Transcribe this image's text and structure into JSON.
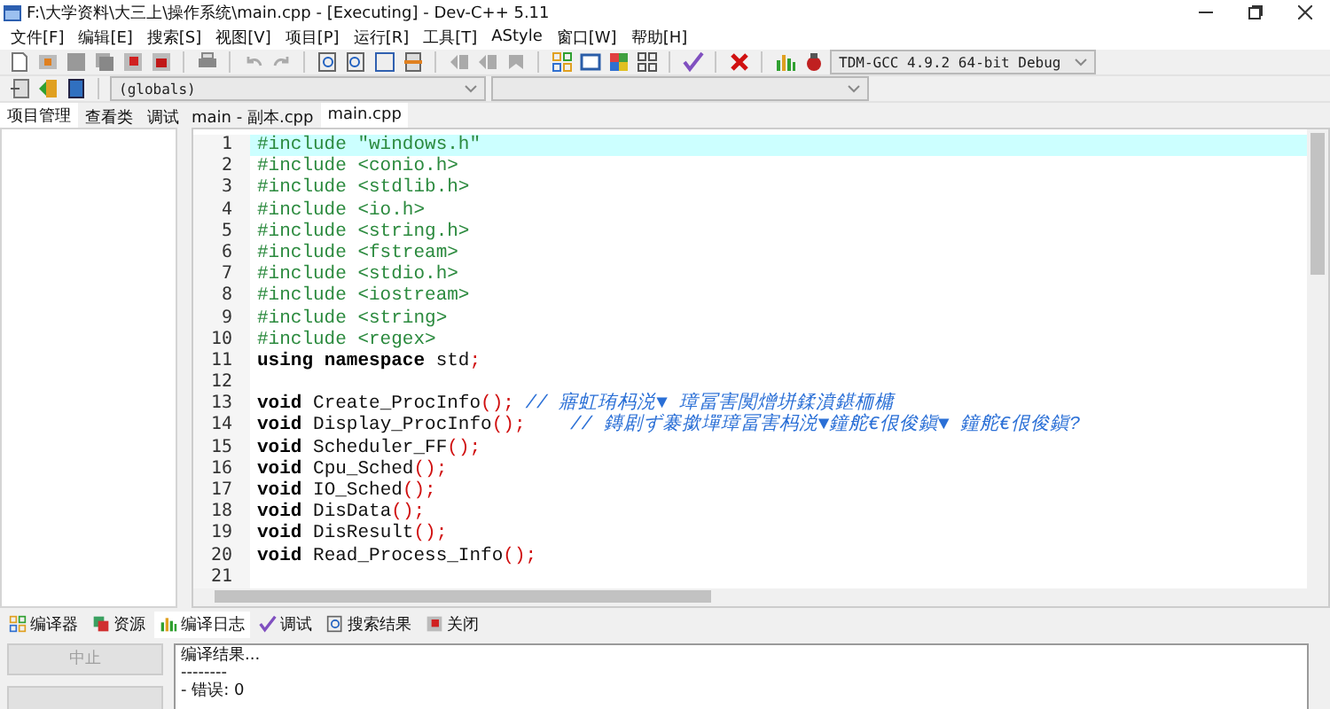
{
  "window": {
    "title": "F:\\大学资料\\大三上\\操作系统\\main.cpp - [Executing] - Dev-C++ 5.11"
  },
  "menu": [
    "文件[F]",
    "编辑[E]",
    "搜索[S]",
    "视图[V]",
    "项目[P]",
    "运行[R]",
    "工具[T]",
    "AStyle",
    "窗口[W]",
    "帮助[H]"
  ],
  "toolbar": {
    "compiler": "TDM-GCC 4.9.2 64-bit Debug",
    "scope": "(globals)"
  },
  "left_tabs": [
    {
      "label": "项目管理",
      "selected": true
    },
    {
      "label": "查看类",
      "selected": false
    },
    {
      "label": "调试",
      "selected": false
    }
  ],
  "editor_tabs": [
    {
      "label": "main - 副本.cpp",
      "selected": false
    },
    {
      "label": "main.cpp",
      "selected": true
    }
  ],
  "code_lines": [
    {
      "number": "1",
      "highlighted": true,
      "tokens": [
        {
          "kind": "pre",
          "text": "#include \"windows.h\""
        }
      ]
    },
    {
      "number": "2",
      "highlighted": false,
      "tokens": [
        {
          "kind": "pre",
          "text": "#include <conio.h>"
        }
      ]
    },
    {
      "number": "3",
      "highlighted": false,
      "tokens": [
        {
          "kind": "pre",
          "text": "#include <stdlib.h>"
        }
      ]
    },
    {
      "number": "4",
      "highlighted": false,
      "tokens": [
        {
          "kind": "pre",
          "text": "#include <io.h>"
        }
      ]
    },
    {
      "number": "5",
      "highlighted": false,
      "tokens": [
        {
          "kind": "pre",
          "text": "#include <string.h>"
        }
      ]
    },
    {
      "number": "6",
      "highlighted": false,
      "tokens": [
        {
          "kind": "pre",
          "text": "#include <fstream>"
        }
      ]
    },
    {
      "number": "7",
      "highlighted": false,
      "tokens": [
        {
          "kind": "pre",
          "text": "#include <stdio.h>"
        }
      ]
    },
    {
      "number": "8",
      "highlighted": false,
      "tokens": [
        {
          "kind": "pre",
          "text": "#include <iostream>"
        }
      ]
    },
    {
      "number": "9",
      "highlighted": false,
      "tokens": [
        {
          "kind": "pre",
          "text": "#include <string>"
        }
      ]
    },
    {
      "number": "10",
      "highlighted": false,
      "tokens": [
        {
          "kind": "pre",
          "text": "#include <regex>"
        }
      ]
    },
    {
      "number": "11",
      "highlighted": false,
      "tokens": [
        {
          "kind": "kw",
          "text": "using"
        },
        {
          "kind": "kw",
          "text": " namespace"
        },
        {
          "kind": "plain",
          "text": " std"
        },
        {
          "kind": "punct",
          "text": ";"
        }
      ]
    },
    {
      "number": "12",
      "highlighted": false
    },
    {
      "number": "13",
      "highlighted": false,
      "tokens": [
        {
          "kind": "kw",
          "text": "void"
        },
        {
          "kind": "plain",
          "text": " Create_ProcInfo"
        },
        {
          "kind": "punct",
          "text": "();"
        },
        {
          "kind": "comment",
          "text": " // 寤虹珛杩涚▼ 璋冨害闃熷垪鍒濆鍖栭槦"
        }
      ]
    },
    {
      "number": "14",
      "highlighted": false,
      "tokens": [
        {
          "kind": "kw",
          "text": "void"
        },
        {
          "kind": "plain",
          "text": " Display_ProcInfo"
        },
        {
          "kind": "punct",
          "text": "();"
        },
        {
          "kind": "comment",
          "text": "    // 鏄剧ず褰撳墠璋冨害杩涚▼鐘舵€佷俊鎭▼ 鐘舵€佷俊鎭?"
        }
      ]
    },
    {
      "number": "15",
      "highlighted": false,
      "tokens": [
        {
          "kind": "kw",
          "text": "void"
        },
        {
          "kind": "plain",
          "text": " Scheduler_FF"
        },
        {
          "kind": "punct",
          "text": "();"
        }
      ]
    },
    {
      "number": "16",
      "highlighted": false,
      "tokens": [
        {
          "kind": "kw",
          "text": "void"
        },
        {
          "kind": "plain",
          "text": " Cpu_Sched"
        },
        {
          "kind": "punct",
          "text": "();"
        }
      ]
    },
    {
      "number": "17",
      "highlighted": false,
      "tokens": [
        {
          "kind": "kw",
          "text": "void"
        },
        {
          "kind": "plain",
          "text": " IO_Sched"
        },
        {
          "kind": "punct",
          "text": "();"
        }
      ]
    },
    {
      "number": "18",
      "highlighted": false,
      "tokens": [
        {
          "kind": "kw",
          "text": "void"
        },
        {
          "kind": "plain",
          "text": " DisData"
        },
        {
          "kind": "punct",
          "text": "();"
        }
      ]
    },
    {
      "number": "19",
      "highlighted": false,
      "tokens": [
        {
          "kind": "kw",
          "text": "void"
        },
        {
          "kind": "plain",
          "text": " DisResult"
        },
        {
          "kind": "punct",
          "text": "();"
        }
      ]
    },
    {
      "number": "20",
      "highlighted": false,
      "tokens": [
        {
          "kind": "kw",
          "text": "void"
        },
        {
          "kind": "plain",
          "text": " Read_Process_Info"
        },
        {
          "kind": "punct",
          "text": "();"
        }
      ]
    },
    {
      "number": "21",
      "highlighted": false
    }
  ],
  "bottom_tabs": [
    {
      "label": "编译器",
      "selected": false
    },
    {
      "label": "资源",
      "selected": false
    },
    {
      "label": "编译日志",
      "selected": true
    },
    {
      "label": "调试",
      "selected": false
    },
    {
      "label": "搜索结果",
      "selected": false
    },
    {
      "label": "关闭",
      "selected": false
    }
  ],
  "abort_button": {
    "label": "中止",
    "disabled": true
  },
  "log": [
    "编译结果...",
    "--------",
    "- 错误: 0"
  ]
}
